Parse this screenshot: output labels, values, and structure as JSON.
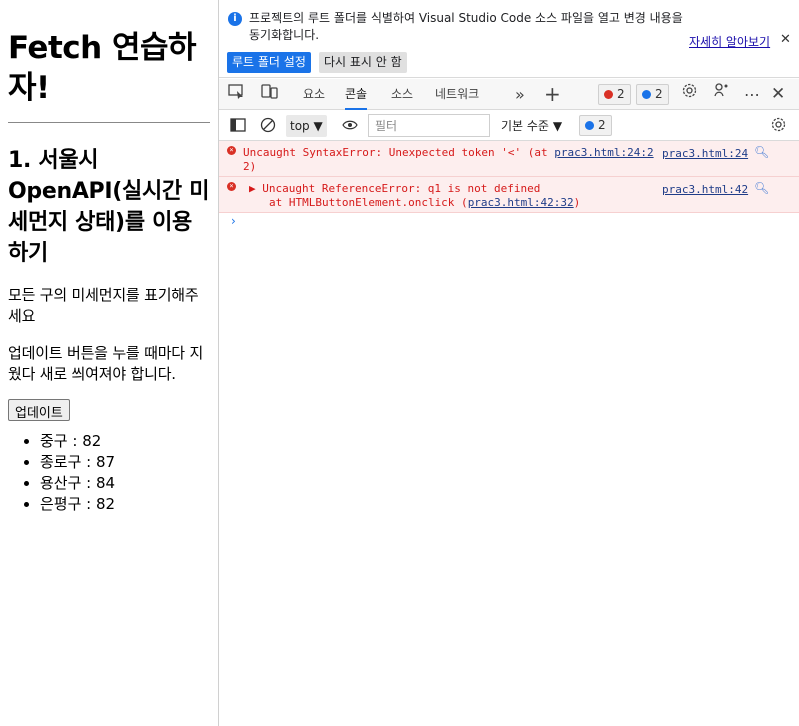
{
  "page": {
    "title": "Fetch 연습하자!",
    "section_heading": "1. 서울시 OpenAPI(실시간 미세먼지 상태)를 이용하기",
    "paragraph1": "모든 구의 미세먼지를 표기해주세요",
    "paragraph2": "업데이트 버튼을 누를 때마다 지웠다 새로 씌여져야 합니다.",
    "update_button": "업데이트",
    "districts": [
      "중구 : 82",
      "종로구 : 87",
      "용산구 : 84",
      "은평구 : 82"
    ]
  },
  "devtools": {
    "infobar": {
      "icon": "info-icon",
      "message": "프로젝트의 루트 폴더를 식별하여 Visual Studio Code 소스 파일을 열고 변경 내용을 동기화합니다.",
      "learn_more": "자세히 알아보기",
      "set_root_button": "루트 폴더 설정",
      "dont_show_button": "다시 표시 안 함",
      "close_symbol": "✕"
    },
    "tabs": [
      "요소",
      "콘솔",
      "소스",
      "네트워크"
    ],
    "active_tab": "콘솔",
    "error_count": "2",
    "message_count": "2",
    "console_toolbar": {
      "context": "top",
      "filter_placeholder": "필터",
      "level": "기본 수준",
      "issues_count": "2"
    },
    "messages": [
      {
        "text_line1": "Uncaught SyntaxError: Unexpected token '<' (at ",
        "inline_source": "prac3.html:24:2",
        "text_line2": "2)",
        "source": "prac3.html:24"
      },
      {
        "text_line1": "▶ Uncaught ReferenceError: q1 is not defined",
        "text_line2_prefix": "at HTMLButtonElement.onclick (",
        "inline_source": "prac3.html:42:32",
        "text_line2_suffix": ")",
        "source": "prac3.html:42"
      }
    ],
    "prompt_symbol": "›",
    "colors": {
      "accent": "#1a73e8",
      "error_text": "#d61a1a",
      "error_bg": "#fdeeee"
    }
  }
}
